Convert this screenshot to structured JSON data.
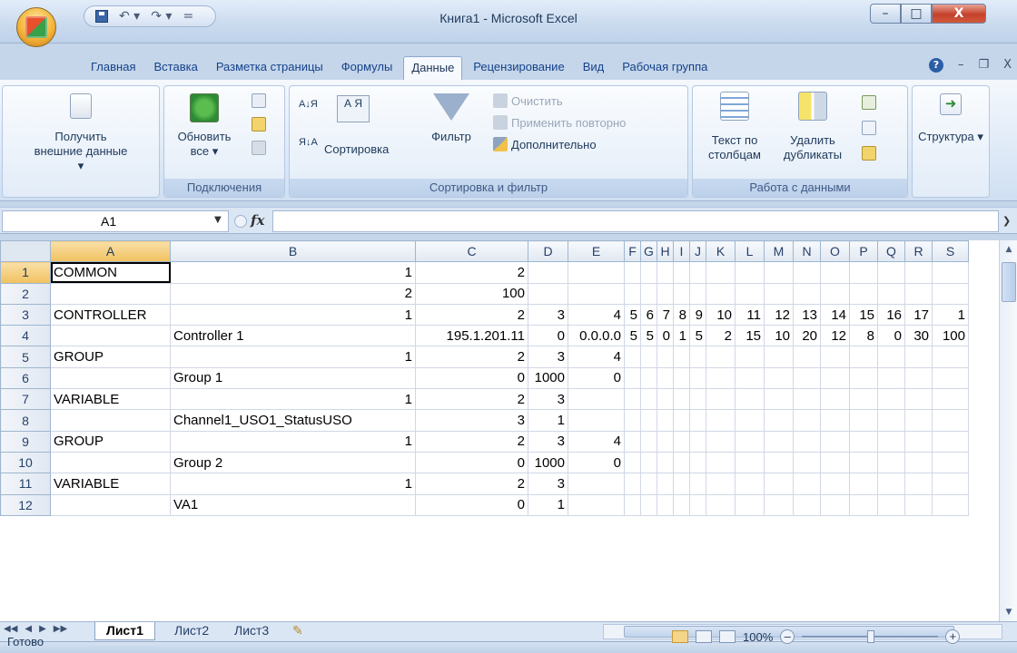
{
  "window": {
    "title": "Книга1 - Microsoft Excel",
    "minimize": "–",
    "maximize": "□",
    "close": "X"
  },
  "qat": {
    "undo": "↶ ▾",
    "redo": "↷ ▾",
    "customize": "="
  },
  "tabs": [
    {
      "label": "Главная",
      "active": false
    },
    {
      "label": "Вставка",
      "active": false
    },
    {
      "label": "Разметка страницы",
      "active": false
    },
    {
      "label": "Формулы",
      "active": false
    },
    {
      "label": "Данные",
      "active": true
    },
    {
      "label": "Рецензирование",
      "active": false
    },
    {
      "label": "Вид",
      "active": false
    },
    {
      "label": "Рабочая группа",
      "active": false
    }
  ],
  "tab_right": {
    "help": "?",
    "minimize": "–",
    "restore": "❐",
    "close": "X"
  },
  "ribbon": {
    "get_external": "Получить внешние данные ▾",
    "refresh_all": "Обновить все ▾",
    "group_connections": "Подключения",
    "sort_az": "А↓Я",
    "sort_za": "Я↓А",
    "sort": "Сортировка",
    "filter": "Фильтр",
    "clear": "Очистить",
    "reapply": "Применить повторно",
    "advanced": "Дополнительно",
    "group_sort_filter": "Сортировка и фильтр",
    "text_to_columns": "Текст по столбцам",
    "remove_duplicates": "Удалить дубликаты",
    "group_data_tools": "Работа с данными",
    "outline": "Структура ▾"
  },
  "formula_bar": {
    "name_box": "A1",
    "fx": "fx",
    "formula": ""
  },
  "columns": [
    "A",
    "B",
    "C",
    "D",
    "E",
    "F",
    "G",
    "H",
    "I",
    "J",
    "K",
    "L",
    "M",
    "N",
    "O",
    "P",
    "Q",
    "R",
    "S"
  ],
  "rows": [
    {
      "n": "1",
      "cells": [
        "COMMON",
        "1",
        "2",
        "",
        "",
        "",
        "",
        "",
        "",
        "",
        "",
        "",
        "",
        "",
        "",
        "",
        "",
        "",
        ""
      ]
    },
    {
      "n": "2",
      "cells": [
        "",
        "2",
        "100",
        "",
        "",
        "",
        "",
        "",
        "",
        "",
        "",
        "",
        "",
        "",
        "",
        "",
        "",
        "",
        ""
      ]
    },
    {
      "n": "3",
      "cells": [
        "CONTROLLER",
        "1",
        "2",
        "3",
        "4",
        "5",
        "6",
        "7",
        "8",
        "9",
        "10",
        "11",
        "12",
        "13",
        "14",
        "15",
        "16",
        "17",
        "1"
      ]
    },
    {
      "n": "4",
      "cells": [
        "",
        "Controller 1",
        "195.1.201.11",
        "0",
        "0.0.0.0",
        "5",
        "5",
        "0",
        "1",
        "5",
        "2",
        "15",
        "10",
        "20",
        "12",
        "8",
        "0",
        "30",
        "100"
      ]
    },
    {
      "n": "5",
      "cells": [
        "GROUP",
        "1",
        "2",
        "3",
        "4",
        "",
        "",
        "",
        "",
        "",
        "",
        "",
        "",
        "",
        "",
        "",
        "",
        "",
        ""
      ]
    },
    {
      "n": "6",
      "cells": [
        "",
        "Group 1",
        "0",
        "1000",
        "0",
        "",
        "",
        "",
        "",
        "",
        "",
        "",
        "",
        "",
        "",
        "",
        "",
        "",
        ""
      ]
    },
    {
      "n": "7",
      "cells": [
        "VARIABLE",
        "1",
        "2",
        "3",
        "",
        "",
        "",
        "",
        "",
        "",
        "",
        "",
        "",
        "",
        "",
        "",
        "",
        "",
        ""
      ]
    },
    {
      "n": "8",
      "cells": [
        "",
        "Channel1_USO1_StatusUSO",
        "3",
        "1",
        "",
        "",
        "",
        "",
        "",
        "",
        "",
        "",
        "",
        "",
        "",
        "",
        "",
        "",
        ""
      ]
    },
    {
      "n": "9",
      "cells": [
        "GROUP",
        "1",
        "2",
        "3",
        "4",
        "",
        "",
        "",
        "",
        "",
        "",
        "",
        "",
        "",
        "",
        "",
        "",
        "",
        ""
      ]
    },
    {
      "n": "10",
      "cells": [
        "",
        "Group 2",
        "0",
        "1000",
        "0",
        "",
        "",
        "",
        "",
        "",
        "",
        "",
        "",
        "",
        "",
        "",
        "",
        "",
        ""
      ]
    },
    {
      "n": "11",
      "cells": [
        "VARIABLE",
        "1",
        "2",
        "3",
        "",
        "",
        "",
        "",
        "",
        "",
        "",
        "",
        "",
        "",
        "",
        "",
        "",
        "",
        ""
      ]
    },
    {
      "n": "12",
      "cells": [
        "",
        "VA1",
        "0",
        "1",
        "",
        "",
        "",
        "",
        "",
        "",
        "",
        "",
        "",
        "",
        "",
        "",
        "",
        "",
        ""
      ]
    }
  ],
  "sheets": [
    "Лист1",
    "Лист2",
    "Лист3"
  ],
  "status": {
    "text": "Готово",
    "zoom": "100%"
  }
}
